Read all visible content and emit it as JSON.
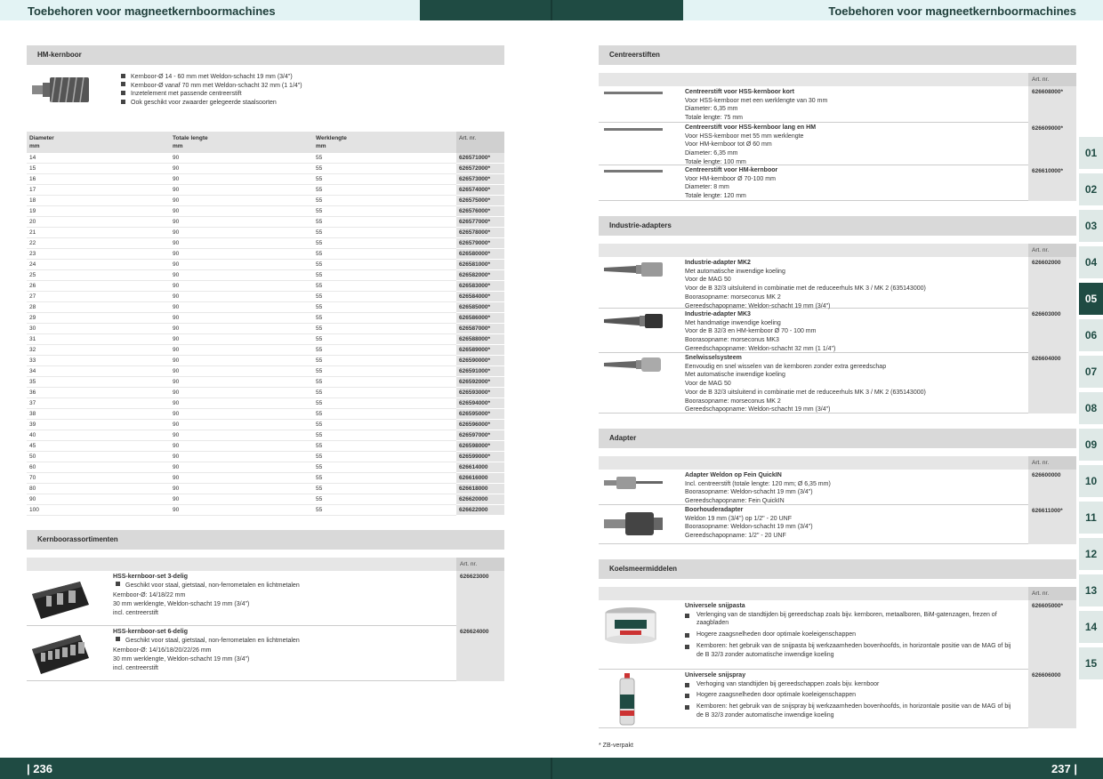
{
  "header": {
    "title_left": "Toebehoren voor magneetkernboormachines",
    "title_right": "Toebehoren voor magneetkernboormachines"
  },
  "footer": {
    "page_left": "| 236",
    "page_right": "237 |",
    "footnote": "* ZB-verpakt"
  },
  "colors": {
    "brand_dark": "#1f4b43",
    "brand_light": "#e3f3f4",
    "section_gray": "#d9d9d9"
  },
  "left": {
    "hm": {
      "title": "HM-kernboor",
      "bullets": [
        "Kernboor-Ø 14 - 60 mm met Weldon-schacht 19 mm (3/4\")",
        "Kernboor-Ø vanaf 70 mm met Weldon-schacht 32 mm (1 1/4\")",
        "Inzetelement met passende centreerstift",
        "Ook geschikt voor zwaarder gelegeerde staalsoorten"
      ]
    },
    "table": {
      "headers": [
        "Diameter\nmm",
        "Totale lengte\nmm",
        "Werklengte\nmm",
        "Art. nr."
      ],
      "rows": [
        [
          "14",
          "90",
          "55",
          "626571000*"
        ],
        [
          "15",
          "90",
          "55",
          "626572000*"
        ],
        [
          "16",
          "90",
          "55",
          "626573000*"
        ],
        [
          "17",
          "90",
          "55",
          "626574000*"
        ],
        [
          "18",
          "90",
          "55",
          "626575000*"
        ],
        [
          "19",
          "90",
          "55",
          "626576000*"
        ],
        [
          "20",
          "90",
          "55",
          "626577000*"
        ],
        [
          "21",
          "90",
          "55",
          "626578000*"
        ],
        [
          "22",
          "90",
          "55",
          "626579000*"
        ],
        [
          "23",
          "90",
          "55",
          "626580000*"
        ],
        [
          "24",
          "90",
          "55",
          "626581000*"
        ],
        [
          "25",
          "90",
          "55",
          "626582000*"
        ],
        [
          "26",
          "90",
          "55",
          "626583000*"
        ],
        [
          "27",
          "90",
          "55",
          "626584000*"
        ],
        [
          "28",
          "90",
          "55",
          "626585000*"
        ],
        [
          "29",
          "90",
          "55",
          "626586000*"
        ],
        [
          "30",
          "90",
          "55",
          "626587000*"
        ],
        [
          "31",
          "90",
          "55",
          "626588000*"
        ],
        [
          "32",
          "90",
          "55",
          "626589000*"
        ],
        [
          "33",
          "90",
          "55",
          "626590000*"
        ],
        [
          "34",
          "90",
          "55",
          "626591000*"
        ],
        [
          "35",
          "90",
          "55",
          "626592000*"
        ],
        [
          "36",
          "90",
          "55",
          "626593000*"
        ],
        [
          "37",
          "90",
          "55",
          "626594000*"
        ],
        [
          "38",
          "90",
          "55",
          "626595000*"
        ],
        [
          "39",
          "90",
          "55",
          "626596000*"
        ],
        [
          "40",
          "90",
          "55",
          "626597000*"
        ],
        [
          "45",
          "90",
          "55",
          "626598000*"
        ],
        [
          "50",
          "90",
          "55",
          "626599000*"
        ],
        [
          "60",
          "90",
          "55",
          "626614000"
        ],
        [
          "70",
          "90",
          "55",
          "626616000"
        ],
        [
          "80",
          "90",
          "55",
          "626618000"
        ],
        [
          "90",
          "90",
          "55",
          "626620000"
        ],
        [
          "100",
          "90",
          "55",
          "626622000"
        ]
      ]
    },
    "sets": {
      "title": "Kernboorassortimenten",
      "art_header": "Art. nr.",
      "items": [
        {
          "name": "HSS-kernboor-set 3-delig",
          "bullet": "Geschikt voor staal, gietstaal, non-ferrometalen en lichtmetalen",
          "lines": [
            "Kernboor-Ø: 14/18/22 mm",
            "30 mm werklengte, Weldon-schacht 19 mm (3/4\")",
            "incl. centreerstift"
          ],
          "art": "626623000"
        },
        {
          "name": "HSS-kernboor-set 6-delig",
          "bullet": "Geschikt voor staal, gietstaal, non-ferrometalen en lichtmetalen",
          "lines": [
            "Kernboor-Ø: 14/16/18/20/22/26 mm",
            "30 mm werklengte, Weldon-schacht 19 mm (3/4\")",
            "incl. centreerstift"
          ],
          "art": "626624000"
        }
      ]
    }
  },
  "right": {
    "centreer": {
      "title": "Centreerstiften",
      "art_header": "Art. nr.",
      "items": [
        {
          "name": "Centreerstift voor HSS-kernboor kort",
          "lines": [
            "Voor HSS-kernboor met een werklengte van 30 mm",
            "Diameter: 6,35 mm",
            "Totale lengte: 75 mm"
          ],
          "art": "626608000*"
        },
        {
          "name": "Centreerstift voor HSS-kernboor lang en HM",
          "lines": [
            "Voor HSS-kernboor met 55 mm werklengte",
            "Voor HM-kernboor tot Ø 60 mm",
            "Diameter: 6,35 mm",
            "Totale lengte: 100 mm"
          ],
          "art": "626609000*"
        },
        {
          "name": "Centreerstift voor HM-kernboor",
          "lines": [
            "Voor HM-kernboor Ø 70-100 mm",
            "Diameter: 8 mm",
            "Totale lengte: 120 mm"
          ],
          "art": "626610000*"
        }
      ]
    },
    "industrie": {
      "title": "Industrie-adapters",
      "art_header": "Art. nr.",
      "items": [
        {
          "name": "Industrie-adapter MK2",
          "lines": [
            "Met automatische inwendige koeling",
            "Voor de MAG 50",
            "Voor de B 32/3 uitsluitend in combinatie met de reduceerhuls MK 3 / MK 2 (635143000)",
            "Boorasopname: morseconus MK 2",
            "Gereedschapopname: Weldon-schacht 19 mm (3/4\")"
          ],
          "art": "626602000"
        },
        {
          "name": "Industrie-adapter MK3",
          "lines": [
            "Met handmatige inwendige koeling",
            "Voor de B 32/3 en HM-kernboor Ø 70 - 100 mm",
            "Boorasopname: morseconus MK3",
            "Gereedschapopname: Weldon-schacht 32 mm (1 1/4\")"
          ],
          "art": "626603000"
        },
        {
          "name": "Snelwisselsysteem",
          "lines": [
            "Eenvoudig en snel wisselen van de kernboren zonder extra gereedschap",
            "Met automatische inwendige koeling",
            "Voor de MAG 50",
            "Voor de B 32/3 uitsluitend in combinatie met de reduceerhuls MK 3 / MK 2 (635143000)",
            "Boorasopname: morseconus MK 2",
            "Gereedschapopname: Weldon-schacht 19 mm (3/4\")"
          ],
          "art": "626604000"
        }
      ]
    },
    "adapter": {
      "title": "Adapter",
      "art_header": "Art. nr.",
      "items": [
        {
          "name": "Adapter Weldon op Fein QuickIN",
          "lines": [
            "Incl. centreerstift (totale lengte: 120 mm; Ø 6,35 mm)",
            "Boorasopname: Weldon-schacht 19 mm (3/4\")",
            "Gereedschapopname: Fein QuickIN"
          ],
          "art": "626600000"
        },
        {
          "name": "Boorhouderadapter",
          "lines": [
            "Weldon 19 mm (3/4\") op 1/2\" - 20 UNF",
            "Boorasopname: Weldon-schacht 19 mm (3/4\")",
            "Gereedschapopname: 1/2\" - 20 UNF"
          ],
          "art": "626611000*"
        }
      ]
    },
    "koel": {
      "title": "Koelsmeermiddelen",
      "art_header": "Art. nr.",
      "items": [
        {
          "name": "Universele snijpasta",
          "bullets": [
            "Verlenging van de standtijden bij gereedschap zoals bijv. kernboren, metaalboren, BiM-gatenzagen, frezen of zaagbladen",
            "Hogere zaagsnelheden door optimale koeleigenschappen",
            "Kernboren: het gebruik van de snijpasta bij werkzaamheden bovenhoofds, in horizontale positie van de MAG of bij de B 32/3 zonder automatische inwendige koeling"
          ],
          "art": "626605000*"
        },
        {
          "name": "Universele snijspray",
          "bullets": [
            "Verhoging van standtijden bij gereedschappen zoals bijv. kernboor",
            "Hogere zaagsnelheden door optimale koeleigenschappen",
            "Kernboren: het gebruik van de snijspray bij werkzaamheden bovenhoofds, in horizontale positie van de MAG of bij de B 32/3 zonder automatische inwendige koeling"
          ],
          "art": "626606000"
        }
      ]
    }
  },
  "tabs": [
    "01",
    "02",
    "03",
    "04",
    "05",
    "06",
    "07",
    "08",
    "09",
    "10",
    "11",
    "12",
    "13",
    "14",
    "15"
  ],
  "active_tab": "05"
}
